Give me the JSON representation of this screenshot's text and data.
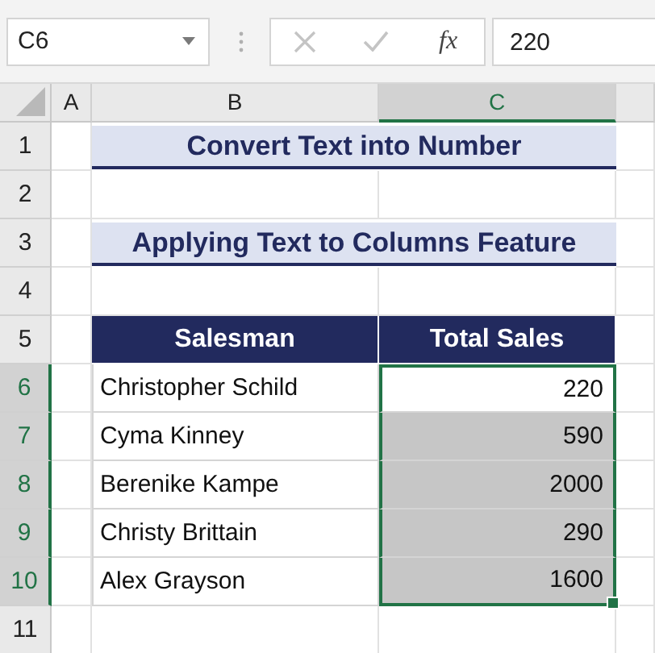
{
  "name_box": {
    "value": "C6"
  },
  "formula_bar": {
    "function_label": "fx",
    "value": "220"
  },
  "columns": [
    {
      "label": "A",
      "selected": false
    },
    {
      "label": "B",
      "selected": false
    },
    {
      "label": "C",
      "selected": true
    }
  ],
  "rows": [
    {
      "number": "1",
      "selected": false,
      "kind": "title",
      "text": "Convert Text into Number"
    },
    {
      "number": "2",
      "selected": false,
      "kind": "blank"
    },
    {
      "number": "3",
      "selected": false,
      "kind": "title",
      "text": "Applying Text to Columns Feature"
    },
    {
      "number": "4",
      "selected": false,
      "kind": "blank"
    },
    {
      "number": "5",
      "selected": false,
      "kind": "header",
      "cells": [
        "Salesman",
        "Total Sales"
      ]
    },
    {
      "number": "6",
      "selected": true,
      "kind": "data",
      "name": "Christopher Schild",
      "sales": "220",
      "sales_selected": true,
      "active": true
    },
    {
      "number": "7",
      "selected": true,
      "kind": "data",
      "name": "Cyma Kinney",
      "sales": "590",
      "sales_selected": true,
      "active": false
    },
    {
      "number": "8",
      "selected": true,
      "kind": "data",
      "name": "Berenike Kampe",
      "sales": "2000",
      "sales_selected": true,
      "active": false
    },
    {
      "number": "9",
      "selected": true,
      "kind": "data",
      "name": "Christy Brittain",
      "sales": "290",
      "sales_selected": true,
      "active": false
    },
    {
      "number": "10",
      "selected": true,
      "kind": "data",
      "name": "Alex Grayson",
      "sales": "1600",
      "sales_selected": true,
      "active": false
    },
    {
      "number": "11",
      "selected": false,
      "kind": "blank"
    }
  ]
}
